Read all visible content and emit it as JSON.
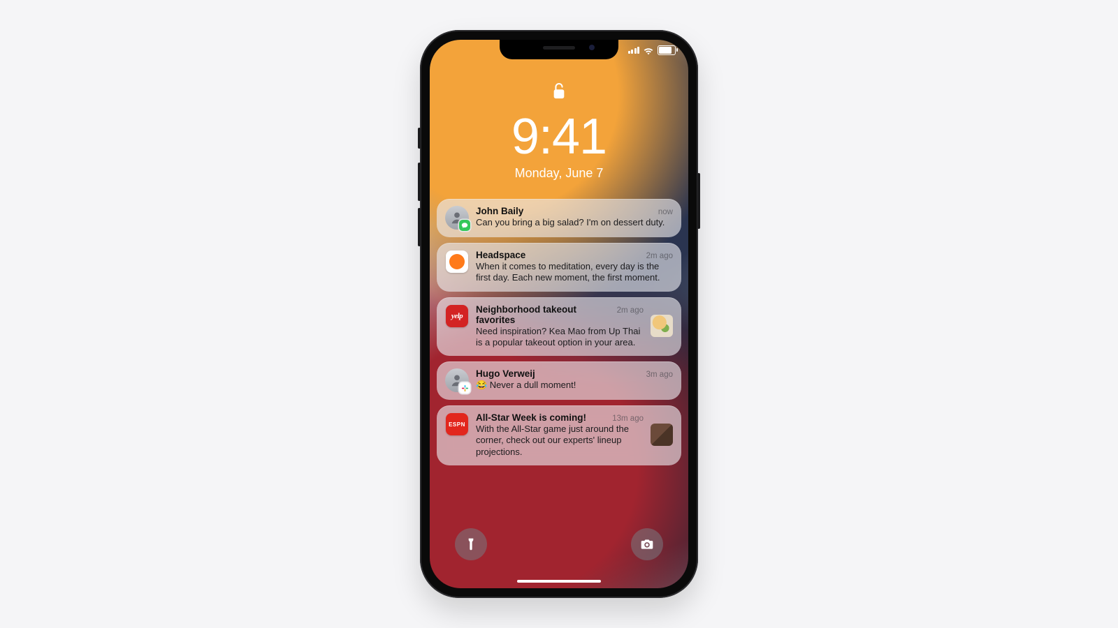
{
  "status": {
    "time": "9:41",
    "date": "Monday, June 7"
  },
  "notifications": [
    {
      "icon": {
        "type": "avatar",
        "badge": "messages",
        "name": "messages-app-icon"
      },
      "title": "John Baily",
      "time": "now",
      "body": "Can you bring a big salad? I'm on dessert duty.",
      "thumb": null
    },
    {
      "icon": {
        "type": "app",
        "style": "headspace",
        "name": "headspace-app-icon"
      },
      "title": "Headspace",
      "time": "2m ago",
      "body": "When it comes to meditation, every day is the first day. Each new moment, the first moment.",
      "thumb": null
    },
    {
      "icon": {
        "type": "app",
        "style": "yelp",
        "label": "yelp",
        "name": "yelp-app-icon"
      },
      "title": "Neighborhood takeout favorites",
      "time": "2m ago",
      "body": "Need inspiration? Kea Mao from Up Thai is a popular takeout option in your area.",
      "thumb": "food"
    },
    {
      "icon": {
        "type": "avatar",
        "badge": "slack",
        "name": "slack-app-icon"
      },
      "title": "Hugo Verweij",
      "time": "3m ago",
      "body": "😂 Never a dull moment!",
      "thumb": null
    },
    {
      "icon": {
        "type": "app",
        "style": "espn",
        "label": "ESPN",
        "name": "espn-app-icon"
      },
      "title": "All-Star Week is coming!",
      "time": "13m ago",
      "body": "With the All-Star game just around the corner, check out our experts' lineup projections.",
      "thumb": "sports"
    }
  ],
  "quick": {
    "flashlight": "Flashlight",
    "camera": "Camera"
  }
}
